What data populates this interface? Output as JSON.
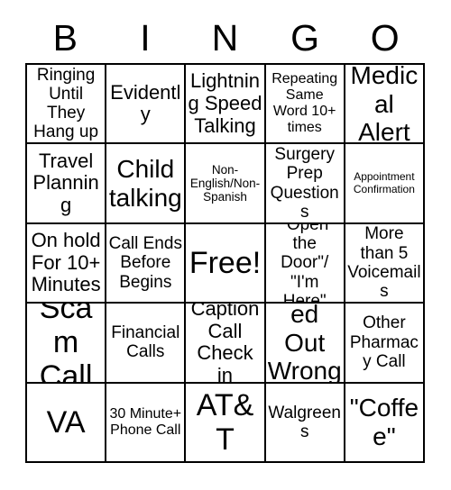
{
  "card": {
    "title": "BINGO Card",
    "header_letters": [
      "B",
      "I",
      "N",
      "G",
      "O"
    ],
    "colors": {
      "background": "#ffffff",
      "text": "#000000",
      "border": "#000000"
    },
    "grid_size": "5x5",
    "free_space_index": 12,
    "cells": [
      {
        "text": "Ringing Until They Hang up",
        "size": "md",
        "marked": false
      },
      {
        "text": "Evidently",
        "size": "lg",
        "marked": false
      },
      {
        "text": "Lightning Speed Talking",
        "size": "lg",
        "marked": false
      },
      {
        "text": "Repeating Same Word 10+ times",
        "size": "sm",
        "marked": false
      },
      {
        "text": "Medical Alert",
        "size": "xl",
        "marked": false
      },
      {
        "text": "Travel Planning",
        "size": "lg",
        "marked": false
      },
      {
        "text": "Child talking",
        "size": "xl",
        "marked": false
      },
      {
        "text": "Non-English/Non-Spanish",
        "size": "xs",
        "marked": false
      },
      {
        "text": "Surgery Prep Questions",
        "size": "md",
        "marked": false
      },
      {
        "text": "Appointment Confirmation",
        "size": "xxs",
        "marked": false
      },
      {
        "text": "On hold For 10+ Minutes",
        "size": "lg",
        "marked": false
      },
      {
        "text": "Call Ends Before Begins",
        "size": "md",
        "marked": false
      },
      {
        "text": "Free!",
        "size": "xxl",
        "marked": false
      },
      {
        "text": "\"Open the Door\"/ \"I'm Here\"",
        "size": "md",
        "marked": false
      },
      {
        "text": "More than 5 Voicemails",
        "size": "md",
        "marked": false
      },
      {
        "text": "Scam Call",
        "size": "xxl",
        "marked": false
      },
      {
        "text": "Financial Calls",
        "size": "md",
        "marked": false
      },
      {
        "text": "Caption Call Check in",
        "size": "lg",
        "marked": false
      },
      {
        "text": "\"Printed Out Wrong\"",
        "size": "xl",
        "marked": false
      },
      {
        "text": "Other Pharmacy Call",
        "size": "md",
        "marked": false
      },
      {
        "text": "VA",
        "size": "xxl",
        "marked": false
      },
      {
        "text": "30 Minute+ Phone Call",
        "size": "sm",
        "marked": false
      },
      {
        "text": "AT&T",
        "size": "xxl",
        "marked": false
      },
      {
        "text": "Walgreens",
        "size": "md",
        "marked": false
      },
      {
        "text": "\"Coffee\"",
        "size": "xl",
        "marked": false
      }
    ]
  }
}
